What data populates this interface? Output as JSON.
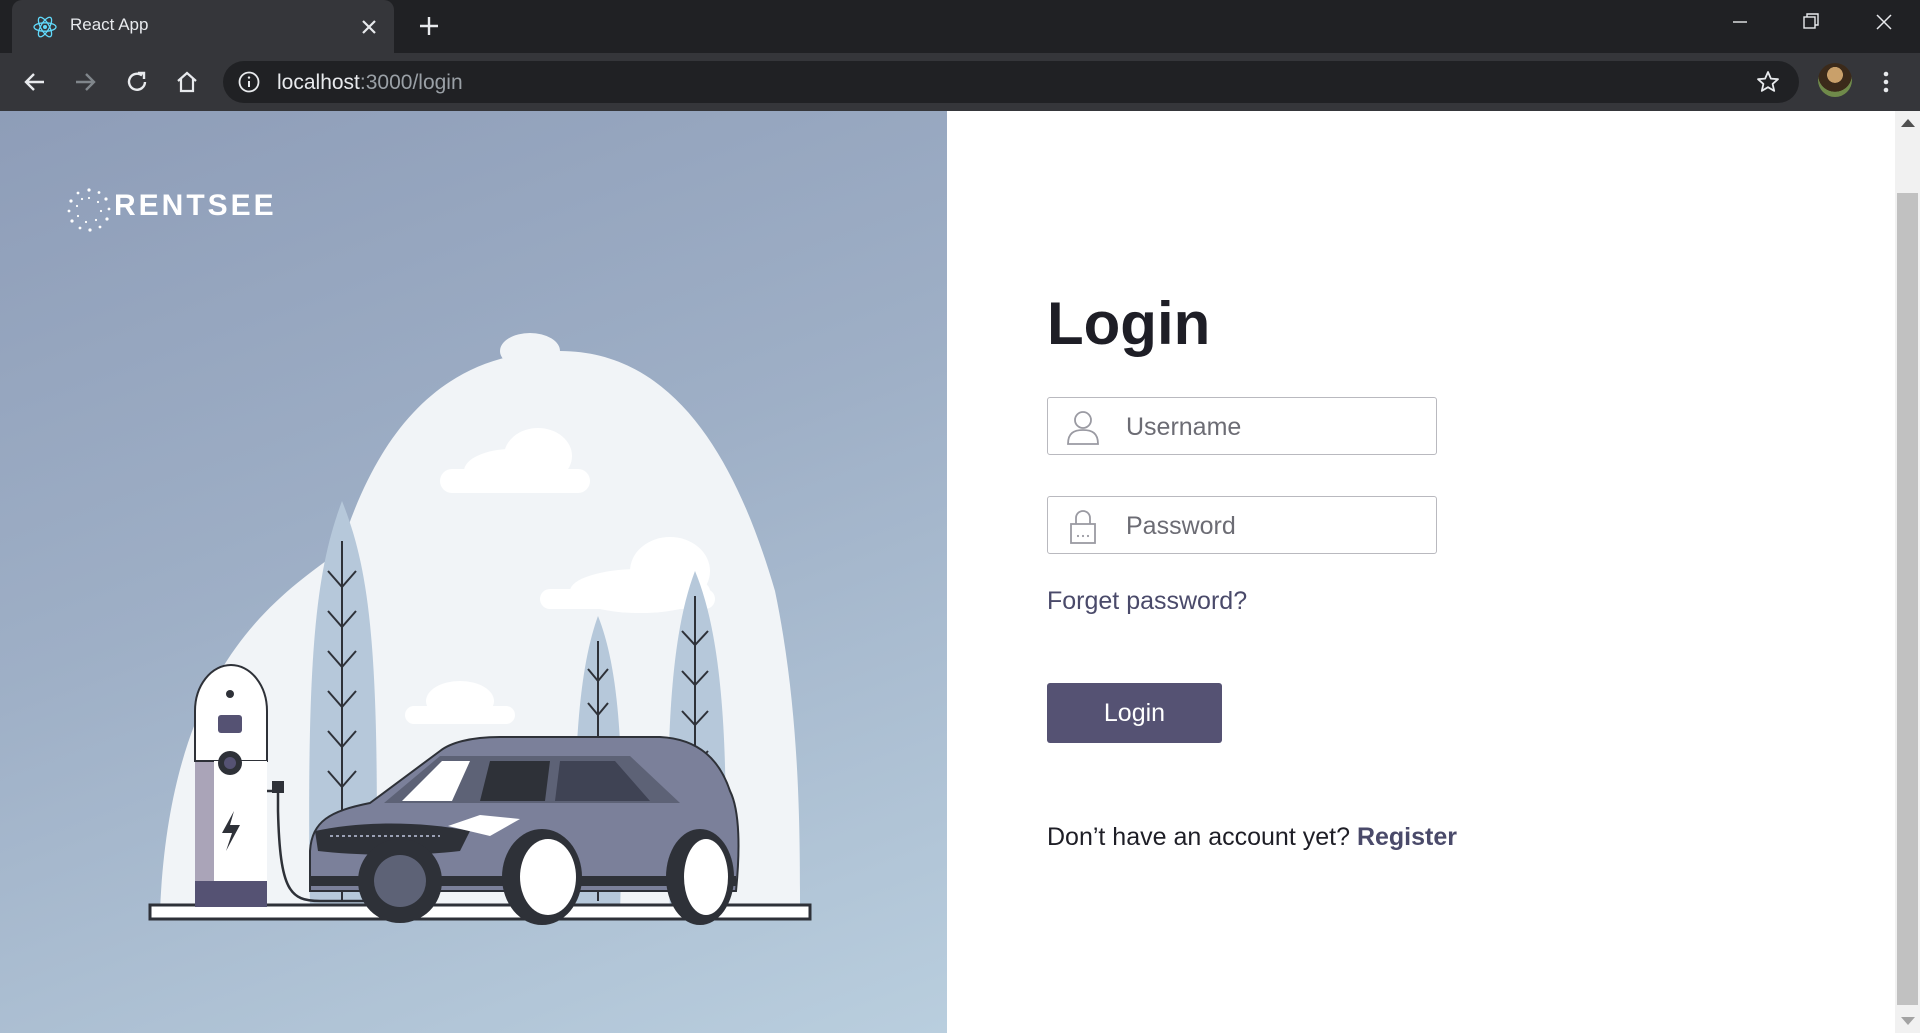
{
  "browser": {
    "tab_title": "React App",
    "url_host": "localhost",
    "url_path": ":3000/login"
  },
  "brand": {
    "name": "RENTSEE"
  },
  "login": {
    "title": "Login",
    "username_placeholder": "Username",
    "password_placeholder": "Password",
    "forgot_label": "Forget password?",
    "submit_label": "Login",
    "register_prompt": "Don’t have an account yet?",
    "register_label": "Register"
  },
  "colors": {
    "primary": "#555273",
    "link": "#4a4a6a",
    "left_panel": "#9eafc6"
  }
}
